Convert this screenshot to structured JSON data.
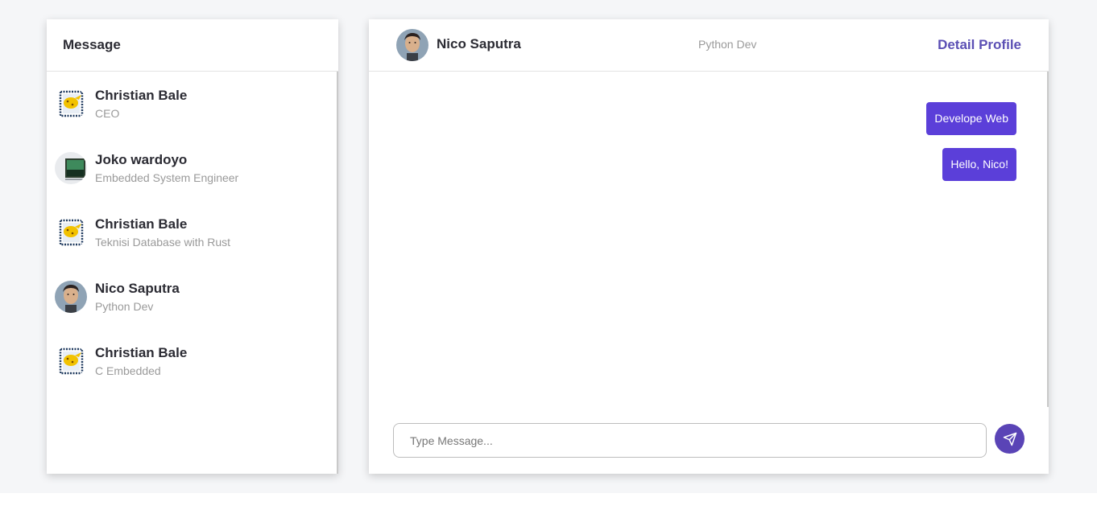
{
  "sidebar": {
    "title": "Message",
    "contacts": [
      {
        "name": "Christian Bale",
        "role": "CEO",
        "avatar": "stamp-avatar"
      },
      {
        "name": "Joko wardoyo",
        "role": "Embedded System Engineer",
        "avatar": "monitor-avatar"
      },
      {
        "name": "Christian Bale",
        "role": "Teknisi Database with Rust",
        "avatar": "stamp-avatar"
      },
      {
        "name": "Nico Saputra",
        "role": "Python Dev",
        "avatar": "photo-avatar"
      },
      {
        "name": "Christian Bale",
        "role": "C Embedded",
        "avatar": "stamp-avatar"
      }
    ]
  },
  "chat": {
    "contact_name": "Nico Saputra",
    "contact_role": "Python Dev",
    "detail_link": "Detail Profile",
    "messages": [
      {
        "text": "Develope Web",
        "sender": "me"
      },
      {
        "text": "Hello, Nico!",
        "sender": "me"
      }
    ],
    "input_placeholder": "Type Message...",
    "send_icon": "send-icon"
  },
  "colors": {
    "accent": "#5b3fd9",
    "link": "#5b4fb4",
    "send_button": "#5a44b6",
    "page_bg": "#f5f6f8"
  }
}
